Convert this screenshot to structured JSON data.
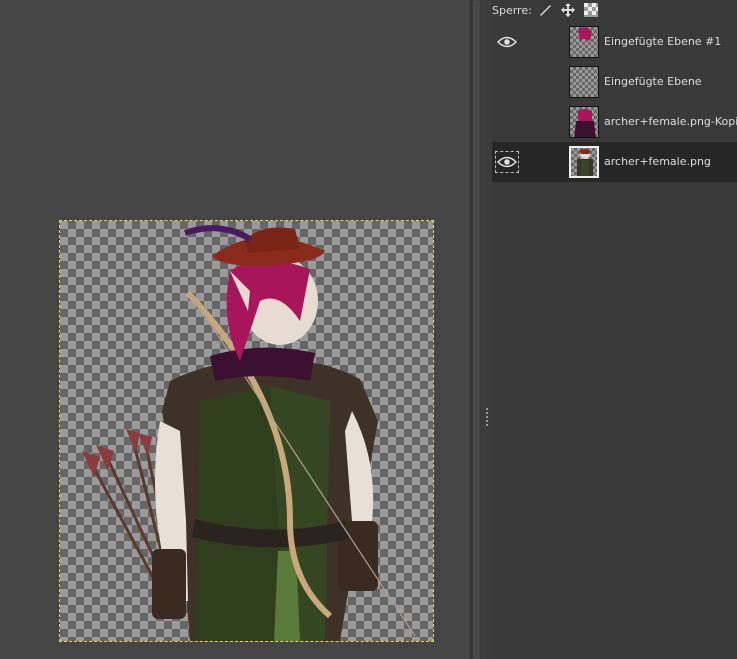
{
  "lock_bar": {
    "label": "Sperre:",
    "icons": [
      "brush-icon",
      "move-icon",
      "checker-icon"
    ]
  },
  "layers": [
    {
      "name": "Eingefügte Ebene #1",
      "visible": true,
      "selected": false,
      "thumb": "magenta-hair"
    },
    {
      "name": "Eingefügte Ebene",
      "visible": false,
      "selected": false,
      "thumb": "empty"
    },
    {
      "name": "archer+female.png-Kopie",
      "visible": false,
      "selected": false,
      "thumb": "hair-figure"
    },
    {
      "name": "archer+female.png",
      "visible": true,
      "selected": true,
      "thumb": "full-figure"
    }
  ],
  "colors": {
    "selection_dash": "#e8d84a",
    "panel_bg": "#393939",
    "canvas_bg": "#454545"
  }
}
